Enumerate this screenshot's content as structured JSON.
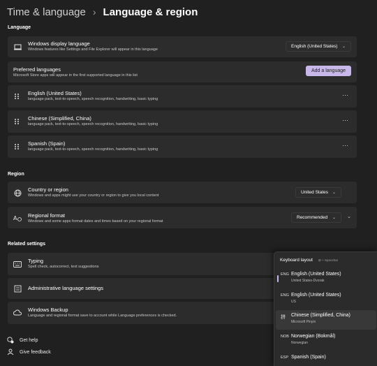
{
  "breadcrumb": {
    "parent": "Time & language",
    "separator": "›",
    "current": "Language & region"
  },
  "sections": {
    "language": "Language",
    "region": "Region",
    "related": "Related settings"
  },
  "display_language": {
    "title": "Windows display language",
    "desc": "Windows features like Settings and File Explorer will appear in this language",
    "value": "English (United States)"
  },
  "preferred": {
    "title": "Preferred languages",
    "desc": "Microsoft Store apps will appear in the first supported language in this list",
    "button": "Add a language"
  },
  "languages": [
    {
      "name": "English (United States)",
      "desc": "language pack, text-to-speech, speech recognition, handwriting, basic typing"
    },
    {
      "name": "Chinese (Simplified, China)",
      "desc": "language pack, text-to-speech, speech recognition, handwriting, basic typing"
    },
    {
      "name": "Spanish (Spain)",
      "desc": "language pack, text-to-speech, speech recognition, handwriting, basic typing"
    }
  ],
  "more_label": "···",
  "country": {
    "title": "Country or region",
    "desc": "Windows and apps might use your country or region to give you local content",
    "value": "United States"
  },
  "format": {
    "title": "Regional format",
    "desc": "Windows and some apps format dates and times based on your regional format",
    "value": "Recommended"
  },
  "typing": {
    "title": "Typing",
    "desc": "Spell check, autocorrect, text suggestions"
  },
  "admin": {
    "title": "Administrative language settings"
  },
  "backup": {
    "title": "Windows Backup",
    "desc": "Language and regional format save to account while Language preferences is checked."
  },
  "footer": {
    "help": "Get help",
    "feedback": "Give feedback"
  },
  "flyout": {
    "title": "Keyboard layout",
    "hint": "⊞ + Spacebar",
    "items": [
      {
        "code": "ENG",
        "name": "English (United States)",
        "sub": "United States-Dvorak"
      },
      {
        "code": "ENG",
        "name": "English (United States)",
        "sub": "US"
      },
      {
        "code": "拼",
        "name": "Chinese (Simplified, China)",
        "sub": "Microsoft Pinyin"
      },
      {
        "code": "NOB",
        "name": "Norwegian (Bokmål)",
        "sub": "Norwegian"
      },
      {
        "code": "ESP",
        "name": "Spanish (Spain)",
        "sub": ""
      }
    ]
  },
  "colors": {
    "accent": "#c8b8ea",
    "background": "#202020",
    "card": "#2c2c2c"
  }
}
